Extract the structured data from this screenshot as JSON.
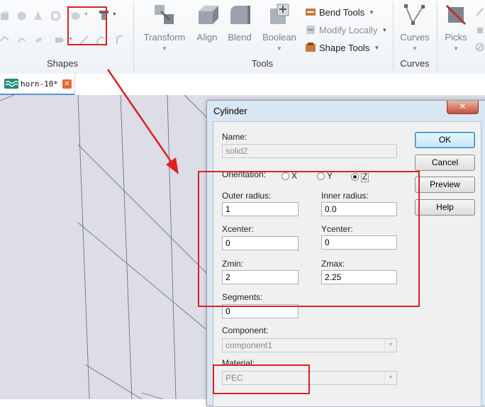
{
  "ribbon": {
    "groups": {
      "shapes": "Shapes",
      "tools": "Tools",
      "curves": "Curves"
    },
    "buttons": {
      "transform": "Transform",
      "align": "Align",
      "blend": "Blend",
      "boolean": "Boolean",
      "curves": "Curves",
      "picks": "Picks",
      "bend_tools": "Bend Tools",
      "modify_locally": "Modify Locally",
      "shape_tools": "Shape Tools"
    },
    "icons": {
      "cylinder_tool": "cylinder-icon",
      "bend": "bend-tools-icon",
      "modify": "modify-locally-icon",
      "shape": "shape-tools-icon"
    }
  },
  "tab": {
    "label": "horn-10*",
    "close": "✕"
  },
  "dialog": {
    "title": "Cylinder",
    "close": "✕",
    "name_label": "Name:",
    "name_value": "solid2",
    "orientation_label": "Orientation:",
    "orient_x": "X",
    "orient_y": "Y",
    "orient_z": "Z",
    "orientation_selected": "Z",
    "outer_radius_label": "Outer radius:",
    "outer_radius_value": "1",
    "inner_radius_label": "Inner radius:",
    "inner_radius_value": "0.0",
    "xcenter_label": "Xcenter:",
    "xcenter_value": "0",
    "ycenter_label": "Ycenter:",
    "ycenter_value": "0",
    "zmin_label": "Zmin:",
    "zmin_value": "2",
    "zmax_label": "Zmax:",
    "zmax_value": "2.25",
    "segments_label": "Segments:",
    "segments_value": "0",
    "component_label": "Component:",
    "component_value": "component1",
    "material_label": "Material:",
    "material_value": "PEC",
    "buttons": {
      "ok": "OK",
      "cancel": "Cancel",
      "preview": "Preview",
      "help": "Help"
    }
  },
  "colors": {
    "annotation_red": "#e02020",
    "dialog_frame": "#d9e6f4",
    "viewport_bg": "#dcdde6"
  }
}
